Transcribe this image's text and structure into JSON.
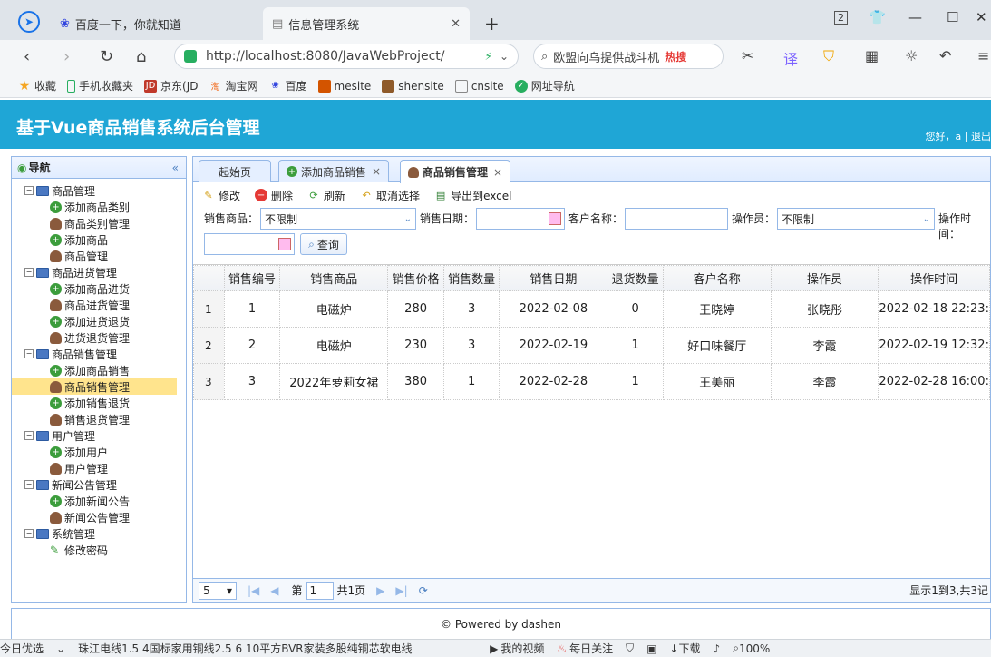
{
  "browser": {
    "tabs": [
      {
        "title": "百度一下，你就知道"
      },
      {
        "title": "信息管理系统"
      }
    ],
    "url": "http://localhost:8080/JavaWebProject/",
    "search_text": "欧盟向乌提供战斗机",
    "search_badge": "热搜",
    "bookmarks": [
      "收藏",
      "手机收藏夹",
      "京东(JD",
      "淘宝网",
      "百度",
      "mesite",
      "shensite",
      "cnsite",
      "网址导航"
    ],
    "tab_count": "2"
  },
  "app": {
    "title": "基于Vue商品销售系统后台管理",
    "user_text": "您好，a | 退出"
  },
  "sidebar": {
    "title": "导航",
    "collapse": "«",
    "groups": [
      {
        "label": "商品管理",
        "items": [
          "添加商品类别",
          "商品类别管理",
          "添加商品",
          "商品管理"
        ]
      },
      {
        "label": "商品进货管理",
        "items": [
          "添加商品进货",
          "商品进货管理",
          "添加进货退货",
          "进货退货管理"
        ]
      },
      {
        "label": "商品销售管理",
        "items": [
          "添加商品销售",
          "商品销售管理",
          "添加销售退货",
          "销售退货管理"
        ]
      },
      {
        "label": "用户管理",
        "items": [
          "添加用户",
          "用户管理"
        ]
      },
      {
        "label": "新闻公告管理",
        "items": [
          "添加新闻公告",
          "新闻公告管理"
        ]
      },
      {
        "label": "系统管理",
        "items": [
          "修改密码"
        ]
      }
    ]
  },
  "page_tabs": [
    {
      "label": "起始页"
    },
    {
      "label": "添加商品销售",
      "close": "×"
    },
    {
      "label": "商品销售管理",
      "close": "×"
    }
  ],
  "toolbar": {
    "edit": "修改",
    "delete": "删除",
    "refresh": "刷新",
    "unselect": "取消选择",
    "export": "导出到excel"
  },
  "filters": {
    "product_label": "销售商品：",
    "product_value": "不限制",
    "date_label": "销售日期：",
    "customer_label": "客户名称：",
    "operator_label": "操作员：",
    "operator_value": "不限制",
    "optime_label": "操作时间：",
    "search_label": "查询"
  },
  "grid": {
    "columns": [
      "销售编号",
      "销售商品",
      "销售价格",
      "销售数量",
      "销售日期",
      "退货数量",
      "客户名称",
      "操作员",
      "操作时间"
    ],
    "rows": [
      {
        "rn": "1",
        "cells": [
          "1",
          "电磁炉",
          "280",
          "3",
          "2022-02-08",
          "0",
          "王晓婷",
          "张晓彤",
          "2022-02-18 22:23:"
        ]
      },
      {
        "rn": "2",
        "cells": [
          "2",
          "电磁炉",
          "230",
          "3",
          "2022-02-19",
          "1",
          "好口味餐厅",
          "李霞",
          "2022-02-19 12:32:"
        ]
      },
      {
        "rn": "3",
        "cells": [
          "3",
          "2022年萝莉女裙",
          "380",
          "1",
          "2022-02-28",
          "1",
          "王美丽",
          "李霞",
          "2022-02-28 16:00:"
        ]
      }
    ]
  },
  "pager": {
    "page_size": "5",
    "page_prefix": "第",
    "page_value": "1",
    "page_total": "共1页",
    "info": "显示1到3,共3记"
  },
  "footer": {
    "text": "© Powered by dashen"
  },
  "statusbar": {
    "items": [
      "今日优选",
      "珠江电线1.5 4国标家用铜线2.5 6 10平方BVR家装多股纯铜芯软电线",
      "我的视频",
      "每日关注",
      "下载",
      "100%"
    ]
  }
}
